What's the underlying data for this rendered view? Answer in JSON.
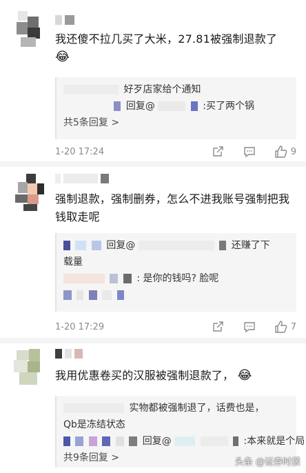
{
  "comments": [
    {
      "text": "我还傻不拉几买了大米，27.81被强制退款了",
      "emoji": "😂",
      "replies": [
        "好歹店家给个通知",
        "回复@",
        ":买了两个锅"
      ],
      "reply_count": "共5条回复 >",
      "time": "1-20 17:24",
      "likes": "9"
    },
    {
      "text": "强制退款，强制删券，怎么不进我账号强制把我钱取走呢",
      "replies": [
        "回复@",
        "还赚了下",
        "载量",
        ": 是你的钱吗? 脸呢"
      ],
      "time": "1-20 17:29",
      "likes": "7"
    },
    {
      "text": "我用优惠卷买的汉服被强制退款了，",
      "emoji": "😂",
      "replies": [
        "实物都被强制退了，话费也是，",
        "Qb是冻结状态",
        "回复@",
        ":本来就是个局"
      ],
      "reply_count": "共9条回复 >"
    }
  ],
  "watermark": "头条 @证券时报",
  "icons": [
    "share-icon",
    "comment-icon",
    "like-icon"
  ]
}
